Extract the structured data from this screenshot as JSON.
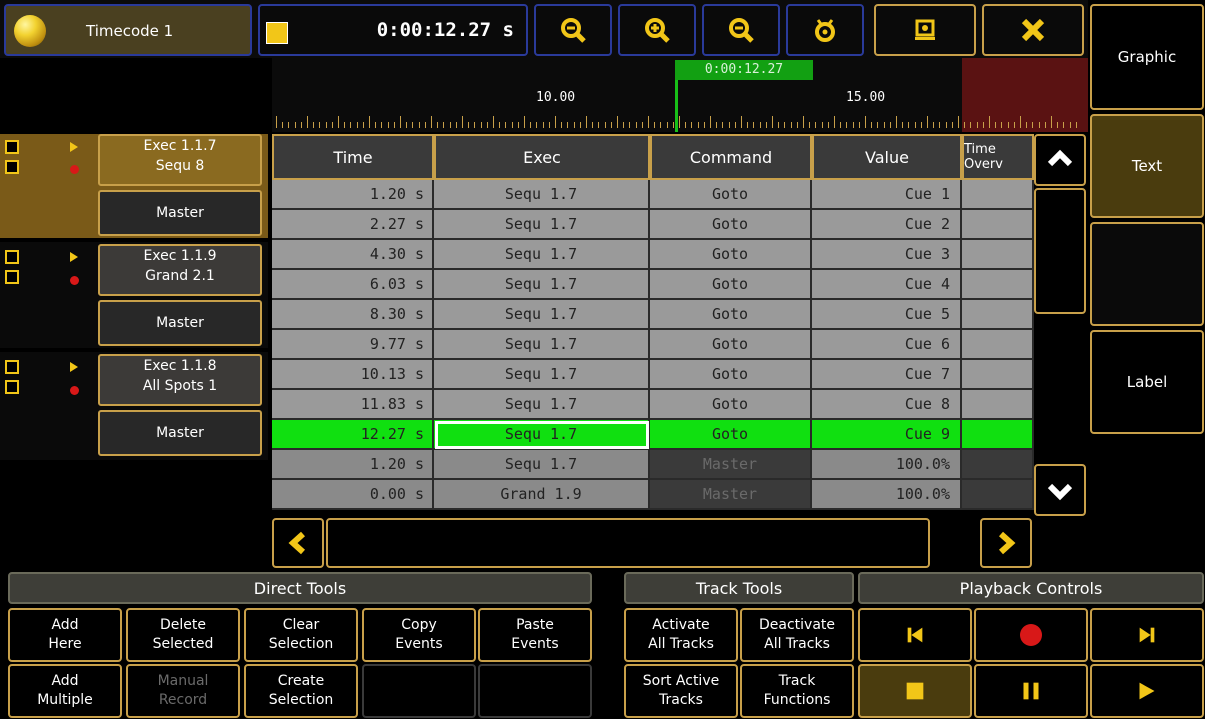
{
  "topbar": {
    "timecode_name": "Timecode 1",
    "time_value": "0:00:12.27 s",
    "buttons": [
      "zoom-out-icon",
      "zoom-in-icon",
      "zoom-fit-icon",
      "settings-icon",
      "screen-icon",
      "close-icon"
    ]
  },
  "ruler": {
    "cursor_time": "0:00:12.27",
    "labels": [
      "10.00",
      "15.00"
    ]
  },
  "execs": [
    {
      "name": "Exec 1.1.7",
      "target": "Sequ 8",
      "master": "Master"
    },
    {
      "name": "Exec 1.1.9",
      "target": "Grand 2.1",
      "master": "Master"
    },
    {
      "name": "Exec 1.1.8",
      "target": "All Spots 1",
      "master": "Master"
    }
  ],
  "table": {
    "headers": [
      "Time",
      "Exec",
      "Command",
      "Value",
      "Time Overv"
    ],
    "rows": [
      {
        "time": "1.20 s",
        "exec": "Sequ 1.7",
        "command": "Goto",
        "value": "Cue 1"
      },
      {
        "time": "2.27 s",
        "exec": "Sequ 1.7",
        "command": "Goto",
        "value": "Cue 2"
      },
      {
        "time": "4.30 s",
        "exec": "Sequ 1.7",
        "command": "Goto",
        "value": "Cue 3"
      },
      {
        "time": "6.03 s",
        "exec": "Sequ 1.7",
        "command": "Goto",
        "value": "Cue 4"
      },
      {
        "time": "8.30 s",
        "exec": "Sequ 1.7",
        "command": "Goto",
        "value": "Cue 5"
      },
      {
        "time": "9.77 s",
        "exec": "Sequ 1.7",
        "command": "Goto",
        "value": "Cue 6"
      },
      {
        "time": "10.13 s",
        "exec": "Sequ 1.7",
        "command": "Goto",
        "value": "Cue 7"
      },
      {
        "time": "11.83 s",
        "exec": "Sequ 1.7",
        "command": "Goto",
        "value": "Cue 8"
      },
      {
        "time": "12.27 s",
        "exec": "Sequ 1.7",
        "command": "Goto",
        "value": "Cue 9"
      },
      {
        "time": "1.20 s",
        "exec": "Sequ 1.7",
        "command": "Master",
        "value": "100.0%"
      },
      {
        "time": "0.00 s",
        "exec": "Grand 1.9",
        "command": "Master",
        "value": "100.0%"
      }
    ]
  },
  "right_panel": {
    "graphic": "Graphic",
    "text": "Text",
    "label": "Label"
  },
  "direct_tools": {
    "title": "Direct Tools",
    "add_here": "Add\nHere",
    "delete_selected": "Delete\nSelected",
    "clear_selection": "Clear\nSelection",
    "copy_events": "Copy\nEvents",
    "paste_events": "Paste\nEvents",
    "add_multiple": "Add\nMultiple",
    "manual_record": "Manual\nRecord",
    "create_selection": "Create\nSelection"
  },
  "track_tools": {
    "title": "Track Tools",
    "activate_all": "Activate\nAll Tracks",
    "deactivate_all": "Deactivate\nAll Tracks",
    "sort_active": "Sort Active\nTracks",
    "track_functions": "Track\nFunctions"
  },
  "playback_controls": {
    "title": "Playback Controls"
  },
  "colors": {
    "accent_border": "#c8a04a",
    "highlight_green": "#10e010",
    "record_red": "#d81818",
    "yellow": "#f2c618"
  }
}
